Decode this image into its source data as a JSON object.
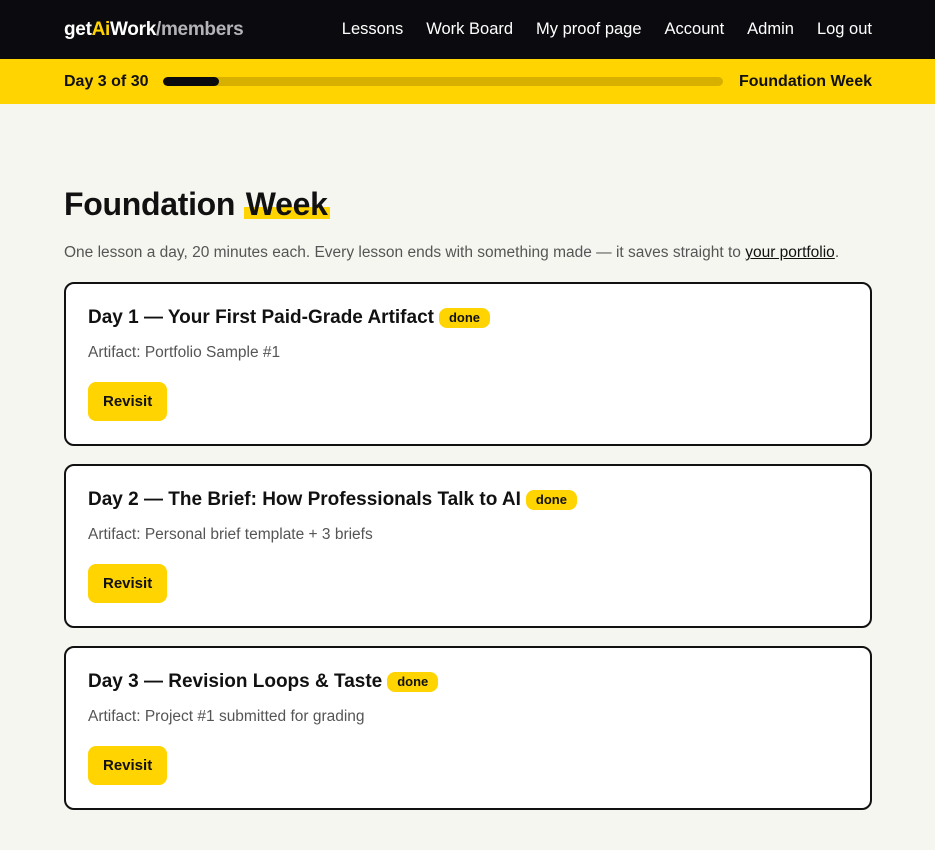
{
  "brand": {
    "part1": "get",
    "part2": "Ai",
    "part3": "Work",
    "part4": "/members",
    "colors": {
      "accent": "#ffd400",
      "nav_bg": "#0b0b0f",
      "page_bg": "#f6f6f1"
    }
  },
  "nav": {
    "items": [
      {
        "label": "Lessons"
      },
      {
        "label": "Work Board"
      },
      {
        "label": "My proof page"
      },
      {
        "label": "Account"
      },
      {
        "label": "Admin"
      },
      {
        "label": "Log out"
      }
    ]
  },
  "progress": {
    "label": "Day 3 of 30",
    "current_day": 3,
    "total_days": 30,
    "fraction": 0.1,
    "week": "Foundation Week"
  },
  "page": {
    "title_main": "Foundation ",
    "title_highlight": "Week",
    "intro": "One lesson a day, 20 minutes each. Every lesson ends with something made — it saves straight to ",
    "intro_link": "your portfolio",
    "intro_end": "."
  },
  "lessons": [
    {
      "title": "Day 1 — Your First Paid-Grade Artifact",
      "badge": "done",
      "artifact": "Artifact: Portfolio Sample #1",
      "button": "Revisit"
    },
    {
      "title": "Day 2 — The Brief: How Professionals Talk to AI",
      "badge": "done",
      "artifact": "Artifact: Personal brief template + 3 briefs",
      "button": "Revisit"
    },
    {
      "title": "Day 3 — Revision Loops & Taste",
      "badge": "done",
      "artifact": "Artifact: Project #1 submitted for grading",
      "button": "Revisit"
    }
  ]
}
